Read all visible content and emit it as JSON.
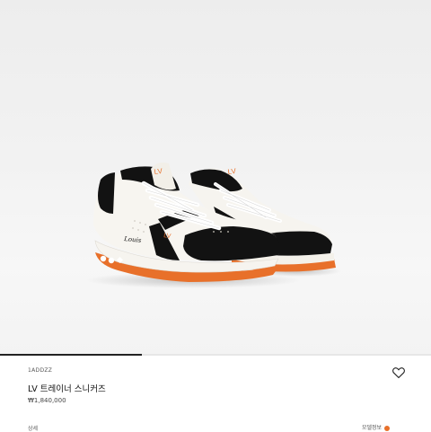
{
  "product": {
    "sku": "1ADDZZ",
    "name": "LV 트레이너 스니커즈",
    "price": "₩1,840,000",
    "image_label": "Louis"
  },
  "gallery": {
    "progress": 0.33
  },
  "footer": {
    "left_text": "상세",
    "right_text": "모델정보"
  },
  "icons": {
    "wishlist": "heart-outline-icon",
    "color_swatch": "color-dot-icon"
  },
  "colors": {
    "accent": "#e8702a",
    "sneaker_black": "#121212",
    "sneaker_white": "#f7f5f0"
  }
}
